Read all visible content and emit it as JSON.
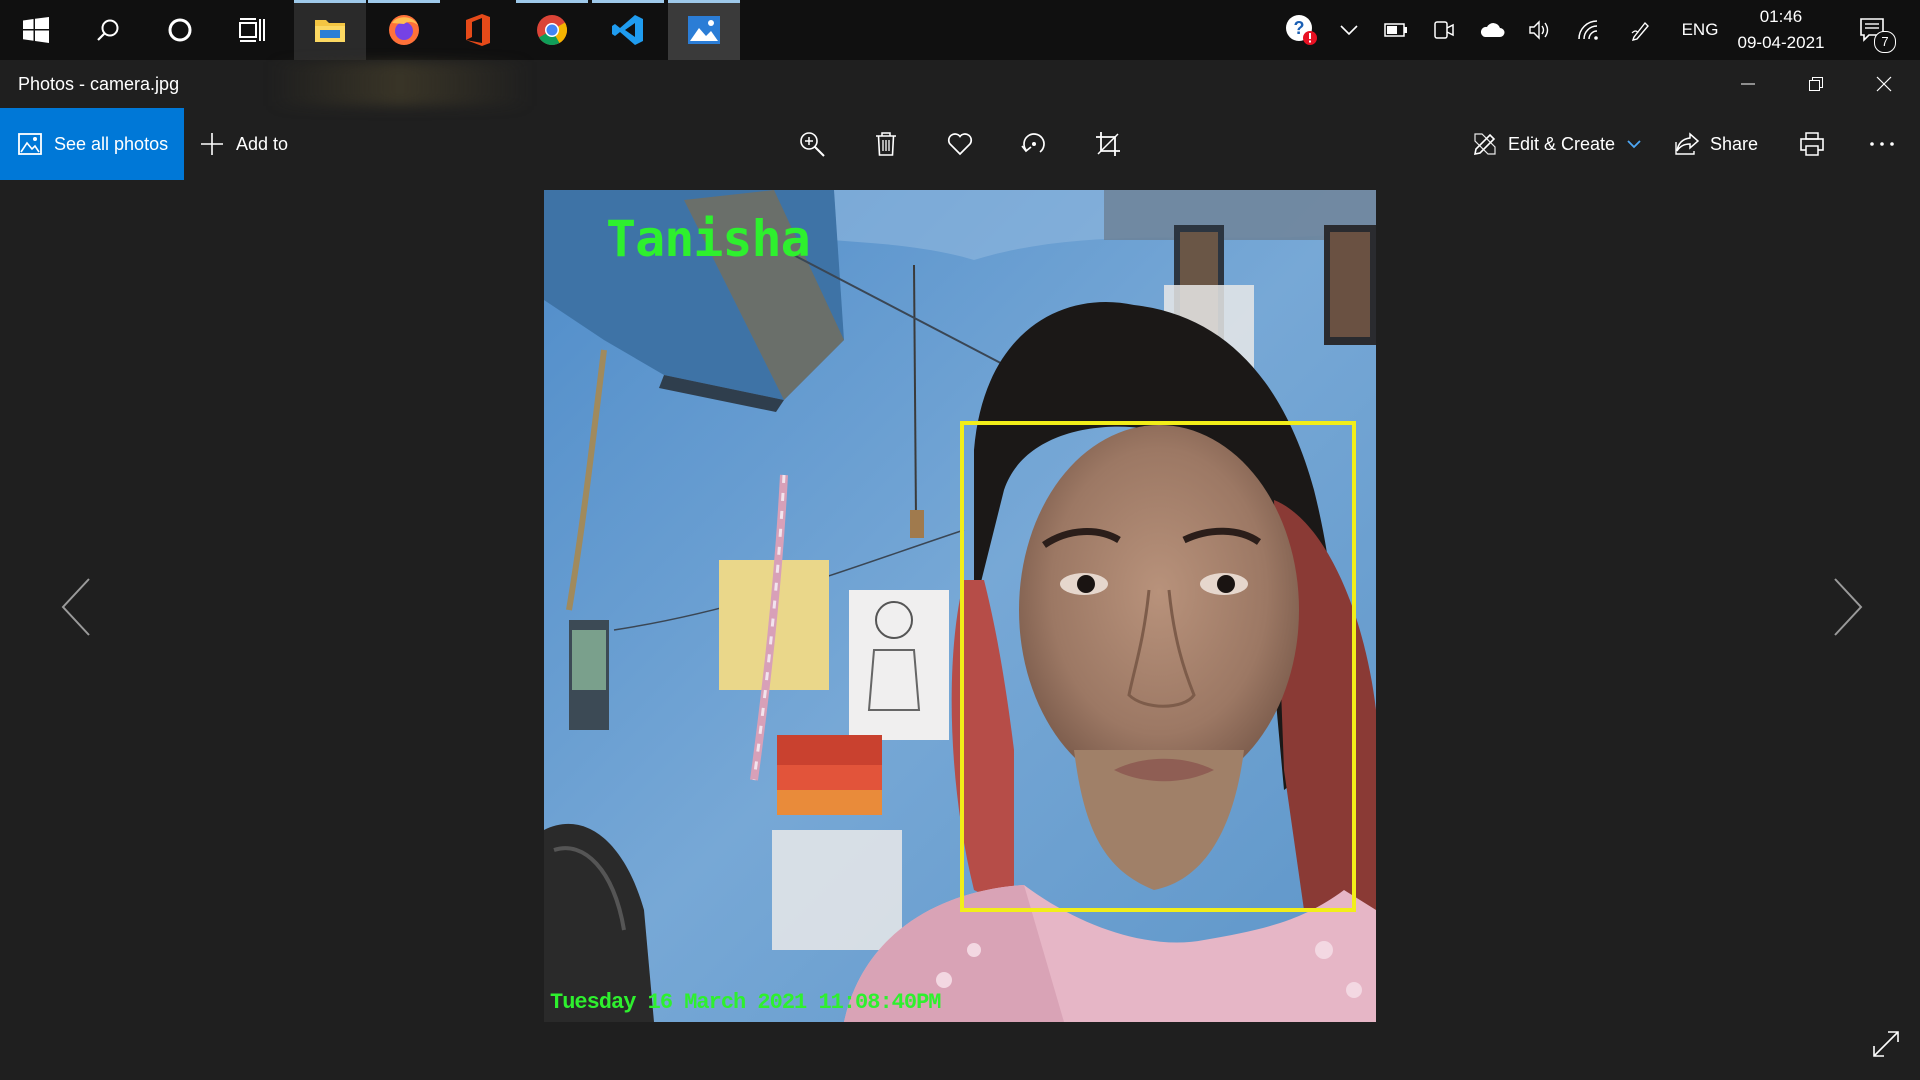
{
  "taskbar": {
    "start_icon": "windows-logo-icon",
    "search_icon": "search-icon",
    "cortana_icon": "cortana-circle-icon",
    "taskview_icon": "task-view-icon",
    "apps": [
      {
        "name": "File Explorer",
        "icon": "folder-icon"
      },
      {
        "name": "Firefox",
        "icon": "firefox-icon"
      },
      {
        "name": "Office",
        "icon": "office-icon"
      },
      {
        "name": "Chrome",
        "icon": "chrome-icon"
      },
      {
        "name": "Visual Studio Code",
        "icon": "vscode-icon"
      },
      {
        "name": "Photos",
        "icon": "photos-icon"
      }
    ],
    "tray": {
      "language": "ENG",
      "time": "01:46",
      "date": "09-04-2021",
      "notification_count": "7"
    }
  },
  "window": {
    "title": "Photos - camera.jpg"
  },
  "toolbar": {
    "see_all_photos": "See all photos",
    "add_to": "Add to",
    "edit_create": "Edit & Create",
    "share": "Share"
  },
  "photo": {
    "name_overlay": "Tanisha",
    "timestamp_overlay": "Tuesday 16 March 2021 11:08:40PM",
    "box_color": "#f2ee19",
    "text_color": "#2ef02e"
  },
  "colors": {
    "accent": "#0078d7",
    "background": "#1f1f1f",
    "taskbar": "#101010"
  }
}
